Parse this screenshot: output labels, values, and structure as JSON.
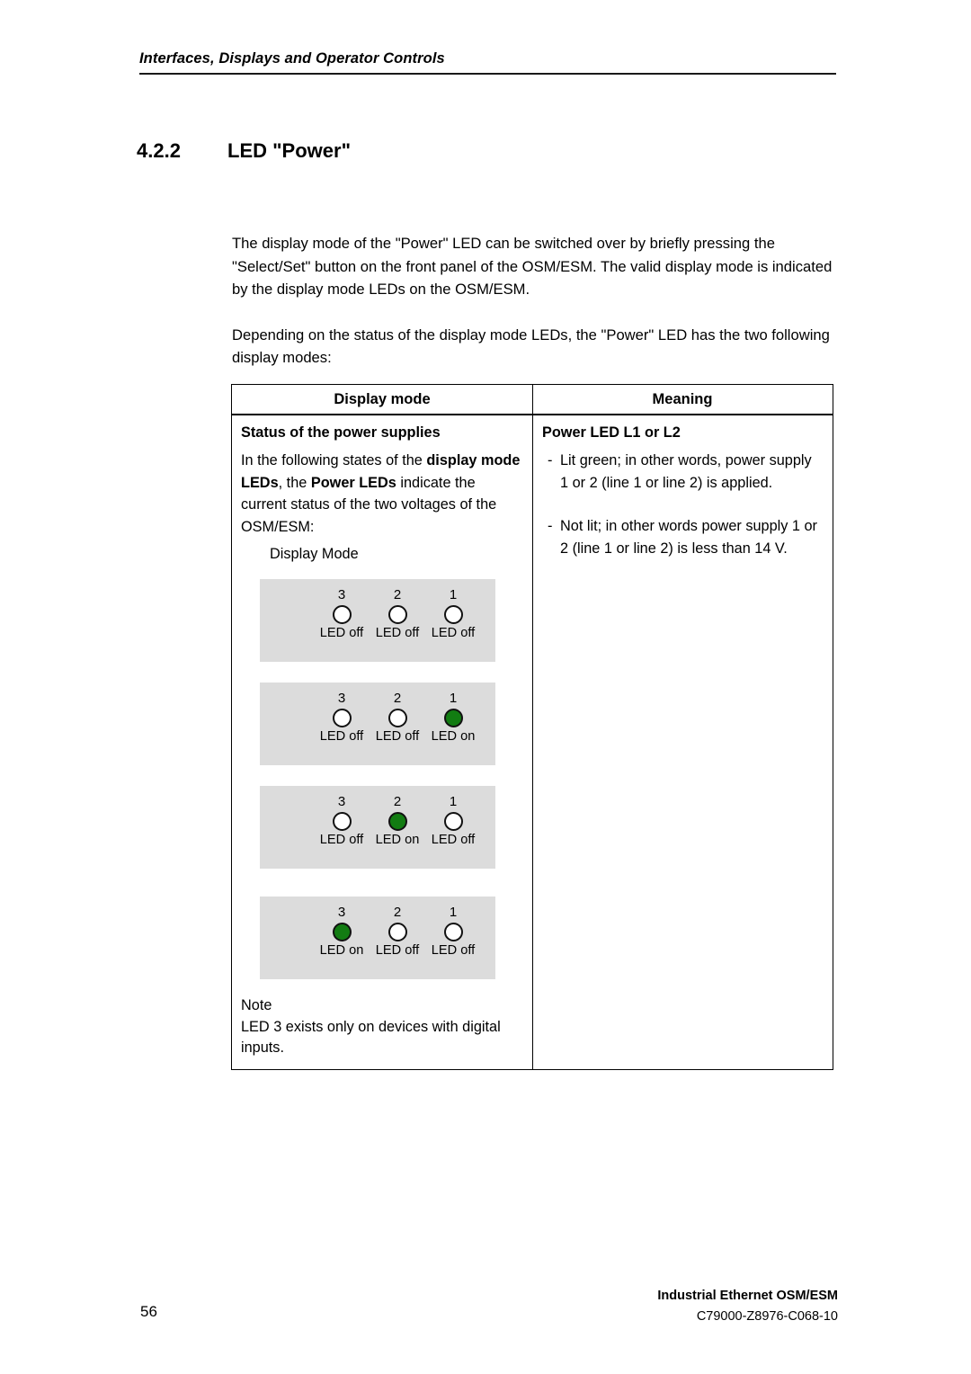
{
  "header": {
    "running_title": "Interfaces, Displays and Operator Controls"
  },
  "section": {
    "number": "4.2.2",
    "title": "LED \"Power\""
  },
  "intro": {
    "paragraph_1": "The display mode of the \"Power\" LED can be switched over by briefly pressing the \"Select/Set\" button on the front panel of the OSM/ESM. The valid display mode is indicated by the display mode LEDs on the OSM/ESM.",
    "paragraph_2": "Depending on the status of the display mode LEDs, the \"Power\" LED has the two following display modes:"
  },
  "table": {
    "headers": {
      "left": "Display mode",
      "right": "Meaning"
    },
    "left_cell": {
      "title": "Status of the power supplies",
      "body_part_1": "In the following states of the ",
      "body_bold_1": "display mode LEDs",
      "body_part_2": ", the ",
      "body_bold_2": "Power LEDs",
      "body_part_3": " indicate the current status of the two voltages of the OSM/ESM:",
      "display_mode_label": "Display Mode",
      "note_title": "Note",
      "note_text": "LED 3 exists only on devices with digital inputs."
    },
    "right_cell": {
      "title": "Power LED L1 or L2",
      "bullets": [
        {
          "marker": "-",
          "text": "Lit green; in other words, power supply 1 or 2 (line 1 or line 2) is applied."
        },
        {
          "marker": "-",
          "text": "Not lit; in other words power supply 1 or 2 (line 1 or line 2) is less than 14 V."
        }
      ]
    }
  },
  "led_panels": [
    {
      "leds": [
        {
          "number": "3",
          "state": "LED off",
          "on": false
        },
        {
          "number": "2",
          "state": "LED off",
          "on": false
        },
        {
          "number": "1",
          "state": "LED off",
          "on": false
        }
      ]
    },
    {
      "leds": [
        {
          "number": "3",
          "state": "LED off",
          "on": false
        },
        {
          "number": "2",
          "state": "LED off",
          "on": false
        },
        {
          "number": "1",
          "state": "LED on",
          "on": true
        }
      ]
    },
    {
      "leds": [
        {
          "number": "3",
          "state": "LED off",
          "on": false
        },
        {
          "number": "2",
          "state": "LED on",
          "on": true
        },
        {
          "number": "1",
          "state": "LED off",
          "on": false
        }
      ]
    },
    {
      "leds": [
        {
          "number": "3",
          "state": "LED on",
          "on": true
        },
        {
          "number": "2",
          "state": "LED off",
          "on": false
        },
        {
          "number": "1",
          "state": "LED off",
          "on": false
        }
      ]
    }
  ],
  "footer": {
    "page_number": "56",
    "product": "Industrial Ethernet OSM/ESM",
    "document_id": "C79000-Z8976-C068-10"
  },
  "colors": {
    "led_on": "#127c12",
    "led_off": "#ffffff",
    "panel_background": "#dcdcdc",
    "rule": "#1a1a1a"
  }
}
